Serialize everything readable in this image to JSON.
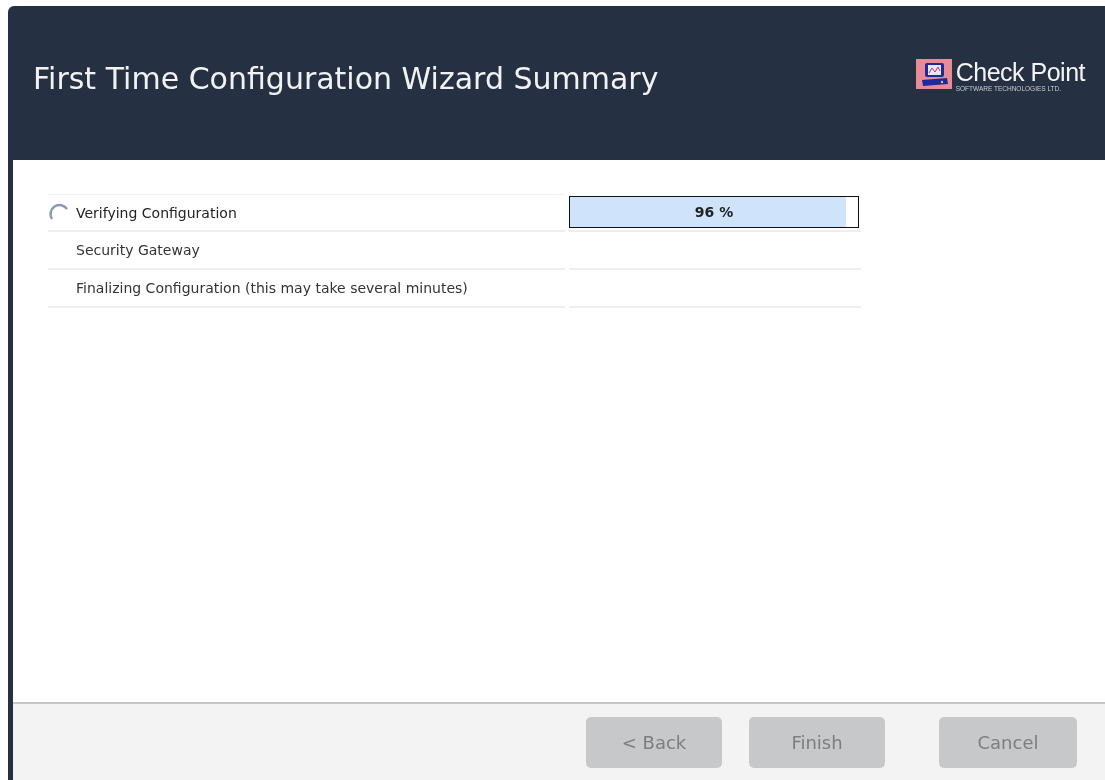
{
  "header": {
    "title": "First Time Configuration Wizard Summary",
    "logo": {
      "name": "Check Point",
      "tagline": "SOFTWARE TECHNOLOGIES LTD."
    }
  },
  "steps": [
    {
      "label": "Verifying Configuration",
      "in_progress": true,
      "level": 0.96,
      "reading": "96 %"
    },
    {
      "label": "Security Gateway",
      "in_progress": false
    },
    {
      "label": "Finalizing Configuration (this may take several minutes)",
      "in_progress": false
    }
  ],
  "buttons": [
    {
      "label": "< Back",
      "disabled": true
    },
    {
      "label": "Finish",
      "disabled": true
    },
    {
      "label": "Cancel",
      "disabled": true
    }
  ]
}
